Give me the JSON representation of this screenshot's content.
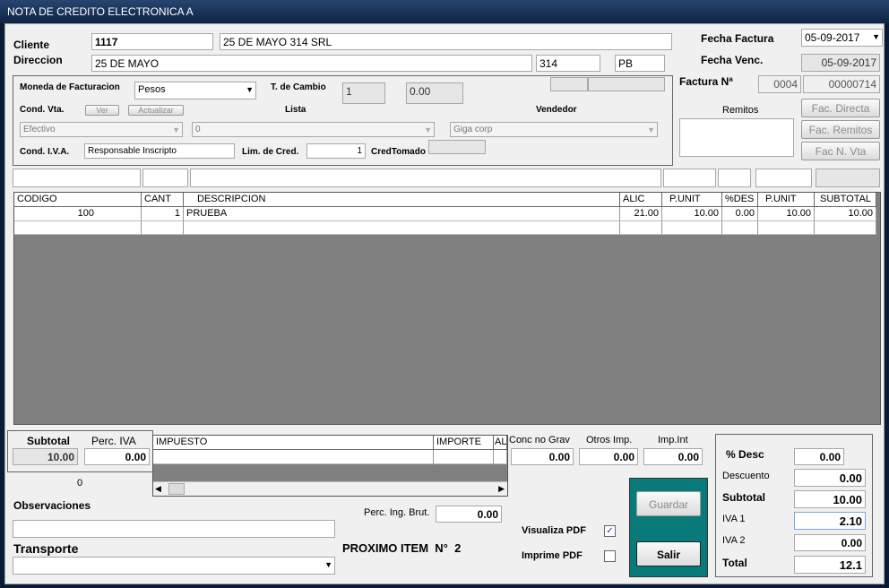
{
  "window": {
    "title": "NOTA DE CREDITO ELECTRONICA A"
  },
  "header": {
    "cliente_label": "Cliente",
    "cliente_code": "1117",
    "cliente_name": "25 DE MAYO 314 SRL",
    "direccion_label": "Direccion",
    "direccion_street": "25 DE MAYO",
    "direccion_number": "314",
    "direccion_floor": "PB",
    "fecha_factura_label": "Fecha Factura",
    "fecha_factura": "05-09-2017",
    "fecha_venc_label": "Fecha Venc.",
    "fecha_venc": "05-09-2017",
    "factura_label": "Factura Nª",
    "factura_pv": "0004",
    "factura_num": "00000714",
    "remitos_label": "Remitos",
    "fac_directa": "Fac. Directa",
    "fac_remitos": "Fac. Remitos",
    "fac_nvta": "Fac N. Vta"
  },
  "billing": {
    "moneda_label": "Moneda de Facturacion",
    "moneda_value": "Pesos",
    "tcambio_label": "T. de Cambio",
    "tcambio_a": "1",
    "tcambio_b": "0.00",
    "condvta_label": "Cond. Vta.",
    "ver_button": "Ver",
    "actualizar_button": "Actualizar",
    "lista_label": "Lista",
    "vendedor_label": "Vendedor",
    "condvta_value": "Efectivo",
    "lista_value": "0",
    "vendedor_value": "Giga corp",
    "condiva_label": "Cond. I.V.A.",
    "condiva_value": "Responsable Inscripto",
    "limcred_label": "Lim. de Cred.",
    "limcred_value": "1",
    "credtomado_label": "CredTomado"
  },
  "items_table": {
    "columns": [
      "CODIGO",
      "CANT",
      "DESCRIPCION",
      "ALIC",
      "P.UNIT",
      "%DES",
      "P.UNIT",
      "SUBTOTAL"
    ],
    "rows": [
      {
        "codigo": "100",
        "cant": "1",
        "descripcion": "PRUEBA",
        "alic": "21.00",
        "punit": "10.00",
        "des": "0.00",
        "punit2": "10.00",
        "subtotal": "10.00"
      }
    ]
  },
  "taxes": {
    "subtotal_label": "Subtotal",
    "subtotal_value": "10.00",
    "perc_iva_label": "Perc. IVA",
    "perc_iva_value": "0.00",
    "col_impuesto": "IMPUESTO",
    "col_importe": "IMPORTE",
    "col_al": "AL",
    "conc_label": "Conc no Grav",
    "conc_value": "0.00",
    "otros_label": "Otros Imp.",
    "otros_value": "0.00",
    "impint_label": "Imp.Int",
    "impint_value": "0.00",
    "counter": "0"
  },
  "footer": {
    "observaciones_label": "Observaciones",
    "transporte_label": "Transporte",
    "perc_ingbrut_label": "Perc. Ing. Brut.",
    "perc_ingbrut_value": "0.00",
    "proximo_item": "PROXIMO ITEM  N°  2",
    "visualiza_pdf_label": "Visualiza PDF",
    "imprime_pdf_label": "Imprime PDF",
    "guardar_button": "Guardar",
    "salir_button": "Salir"
  },
  "totals": {
    "desc_pct_label": "% Desc",
    "desc_pct_value": "0.00",
    "descuento_label": "Descuento",
    "descuento_value": "0.00",
    "subtotal_label": "Subtotal",
    "subtotal_value": "10.00",
    "iva1_label": "IVA 1",
    "iva1_value": "2.10",
    "iva2_label": "IVA 2",
    "iva2_value": "0.00",
    "total_label": "Total",
    "total_value": "12.1"
  },
  "icons": {
    "dropdown": "▼",
    "check": "✓",
    "scroll_left": "◀",
    "scroll_right": "▶"
  }
}
